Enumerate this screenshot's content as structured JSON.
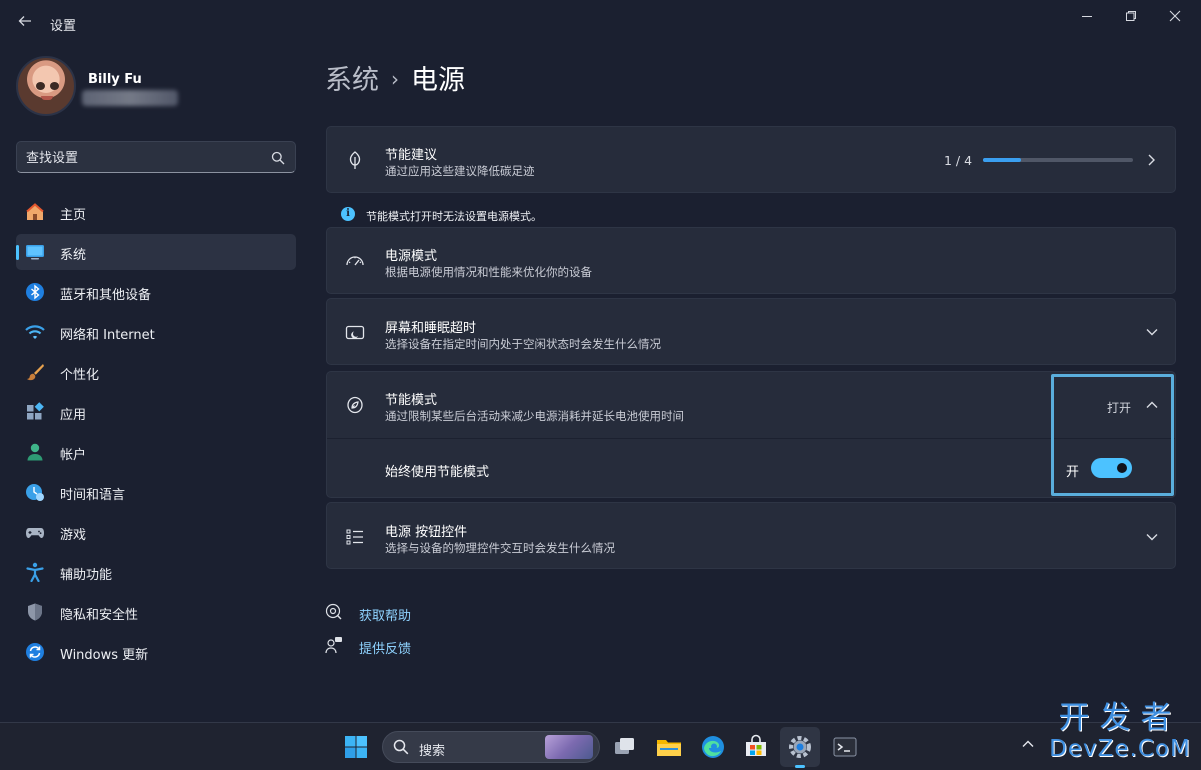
{
  "window": {
    "title": "设置"
  },
  "profile": {
    "name": "Billy Fu"
  },
  "search": {
    "placeholder": "查找设置"
  },
  "sidebar": {
    "items": [
      {
        "label": "主页",
        "icon": "home-icon"
      },
      {
        "label": "系统",
        "icon": "system-icon",
        "active": true
      },
      {
        "label": "蓝牙和其他设备",
        "icon": "bluetooth-icon"
      },
      {
        "label": "网络和 Internet",
        "icon": "wifi-icon"
      },
      {
        "label": "个性化",
        "icon": "brush-icon"
      },
      {
        "label": "应用",
        "icon": "apps-icon"
      },
      {
        "label": "帐户",
        "icon": "account-icon"
      },
      {
        "label": "时间和语言",
        "icon": "time-language-icon"
      },
      {
        "label": "游戏",
        "icon": "gaming-icon"
      },
      {
        "label": "辅助功能",
        "icon": "accessibility-icon"
      },
      {
        "label": "隐私和安全性",
        "icon": "shield-icon"
      },
      {
        "label": "Windows 更新",
        "icon": "update-icon"
      }
    ]
  },
  "breadcrumb": {
    "parent": "系统",
    "separator": "›",
    "current": "电源"
  },
  "energy_recommendations": {
    "title": "节能建议",
    "description": "通过应用这些建议降低碳足迹",
    "progress_text": "1 / 4",
    "progress_fraction": 0.25
  },
  "info_banner": {
    "text": "节能模式打开时无法设置电源模式。"
  },
  "power_mode": {
    "title": "电源模式",
    "description": "根据电源使用情况和性能来优化你的设备"
  },
  "screen_sleep": {
    "title": "屏幕和睡眠超时",
    "description": "选择设备在指定时间内处于空闲状态时会发生什么情况"
  },
  "energy_saver": {
    "title": "节能模式",
    "description": "通过限制某些后台活动来减少电源消耗并延长电池使用时间",
    "status": "打开",
    "always_use_label": "始终使用节能模式",
    "toggle_state_label": "开",
    "toggle_on": true
  },
  "power_button": {
    "title": "电源 按钮控件",
    "description": "选择与设备的物理控件交互时会发生什么情况"
  },
  "links": {
    "help": "获取帮助",
    "feedback": "提供反馈"
  },
  "taskbar": {
    "search_label": "搜索"
  },
  "watermark": {
    "line1": "开发者",
    "line2": "DevZe.CoM"
  },
  "colors": {
    "accent": "#4cc2ff",
    "background": "#1b2030",
    "card": "#262c3b",
    "link": "#8fd3ff",
    "highlight_border": "#5aaedc"
  }
}
